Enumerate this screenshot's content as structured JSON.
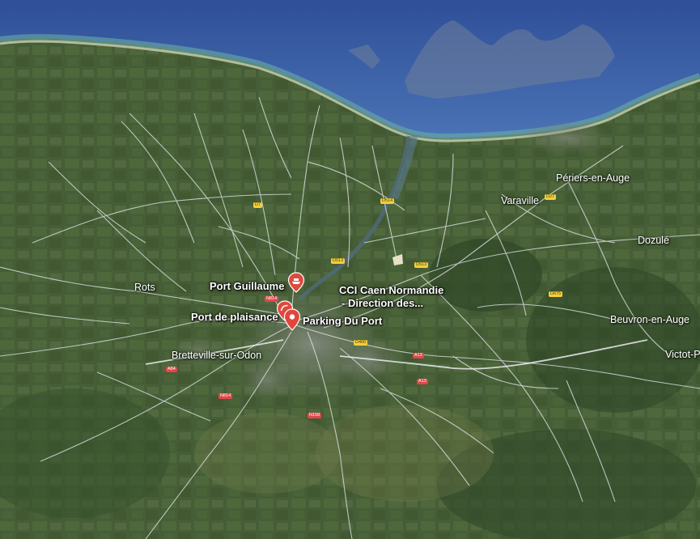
{
  "colors": {
    "sea": "#3b5fa8",
    "land": "#465e38",
    "road": "#e8ecef",
    "marker": "#dd4b3e",
    "label": "#ffffff"
  },
  "places": {
    "rots": "Rots",
    "bretteville": "Bretteville-sur-Odon",
    "varaville": "Varaville",
    "periers": "Périers-en-Auge",
    "dozule": "Dozulé",
    "beuvron": "Beuvron-en-Auge",
    "victot": "Victot-P"
  },
  "pois": {
    "port_guillaume": "Port Guillaume",
    "cci_line1": "CCI Caen Normandie",
    "cci_line2": "- Direction des...",
    "port_plaisance": "Port de plaisance",
    "parking": "Parking Du Port"
  },
  "roads": {
    "d7": "D7",
    "d514": "D514",
    "d513a": "D513",
    "d513b": "D513",
    "d27": "D27",
    "d400": "D400",
    "n814": "N814",
    "a84": "A84",
    "n814b": "N814",
    "n158": "N158",
    "a13": "A13",
    "a13b": "A13",
    "d675": "D675",
    "d515": "D515"
  },
  "markers": {
    "port_guillaume": "ferry-marker-icon",
    "port_plaisance": "harbor-marker-icon",
    "parking": "location-pin-icon"
  }
}
